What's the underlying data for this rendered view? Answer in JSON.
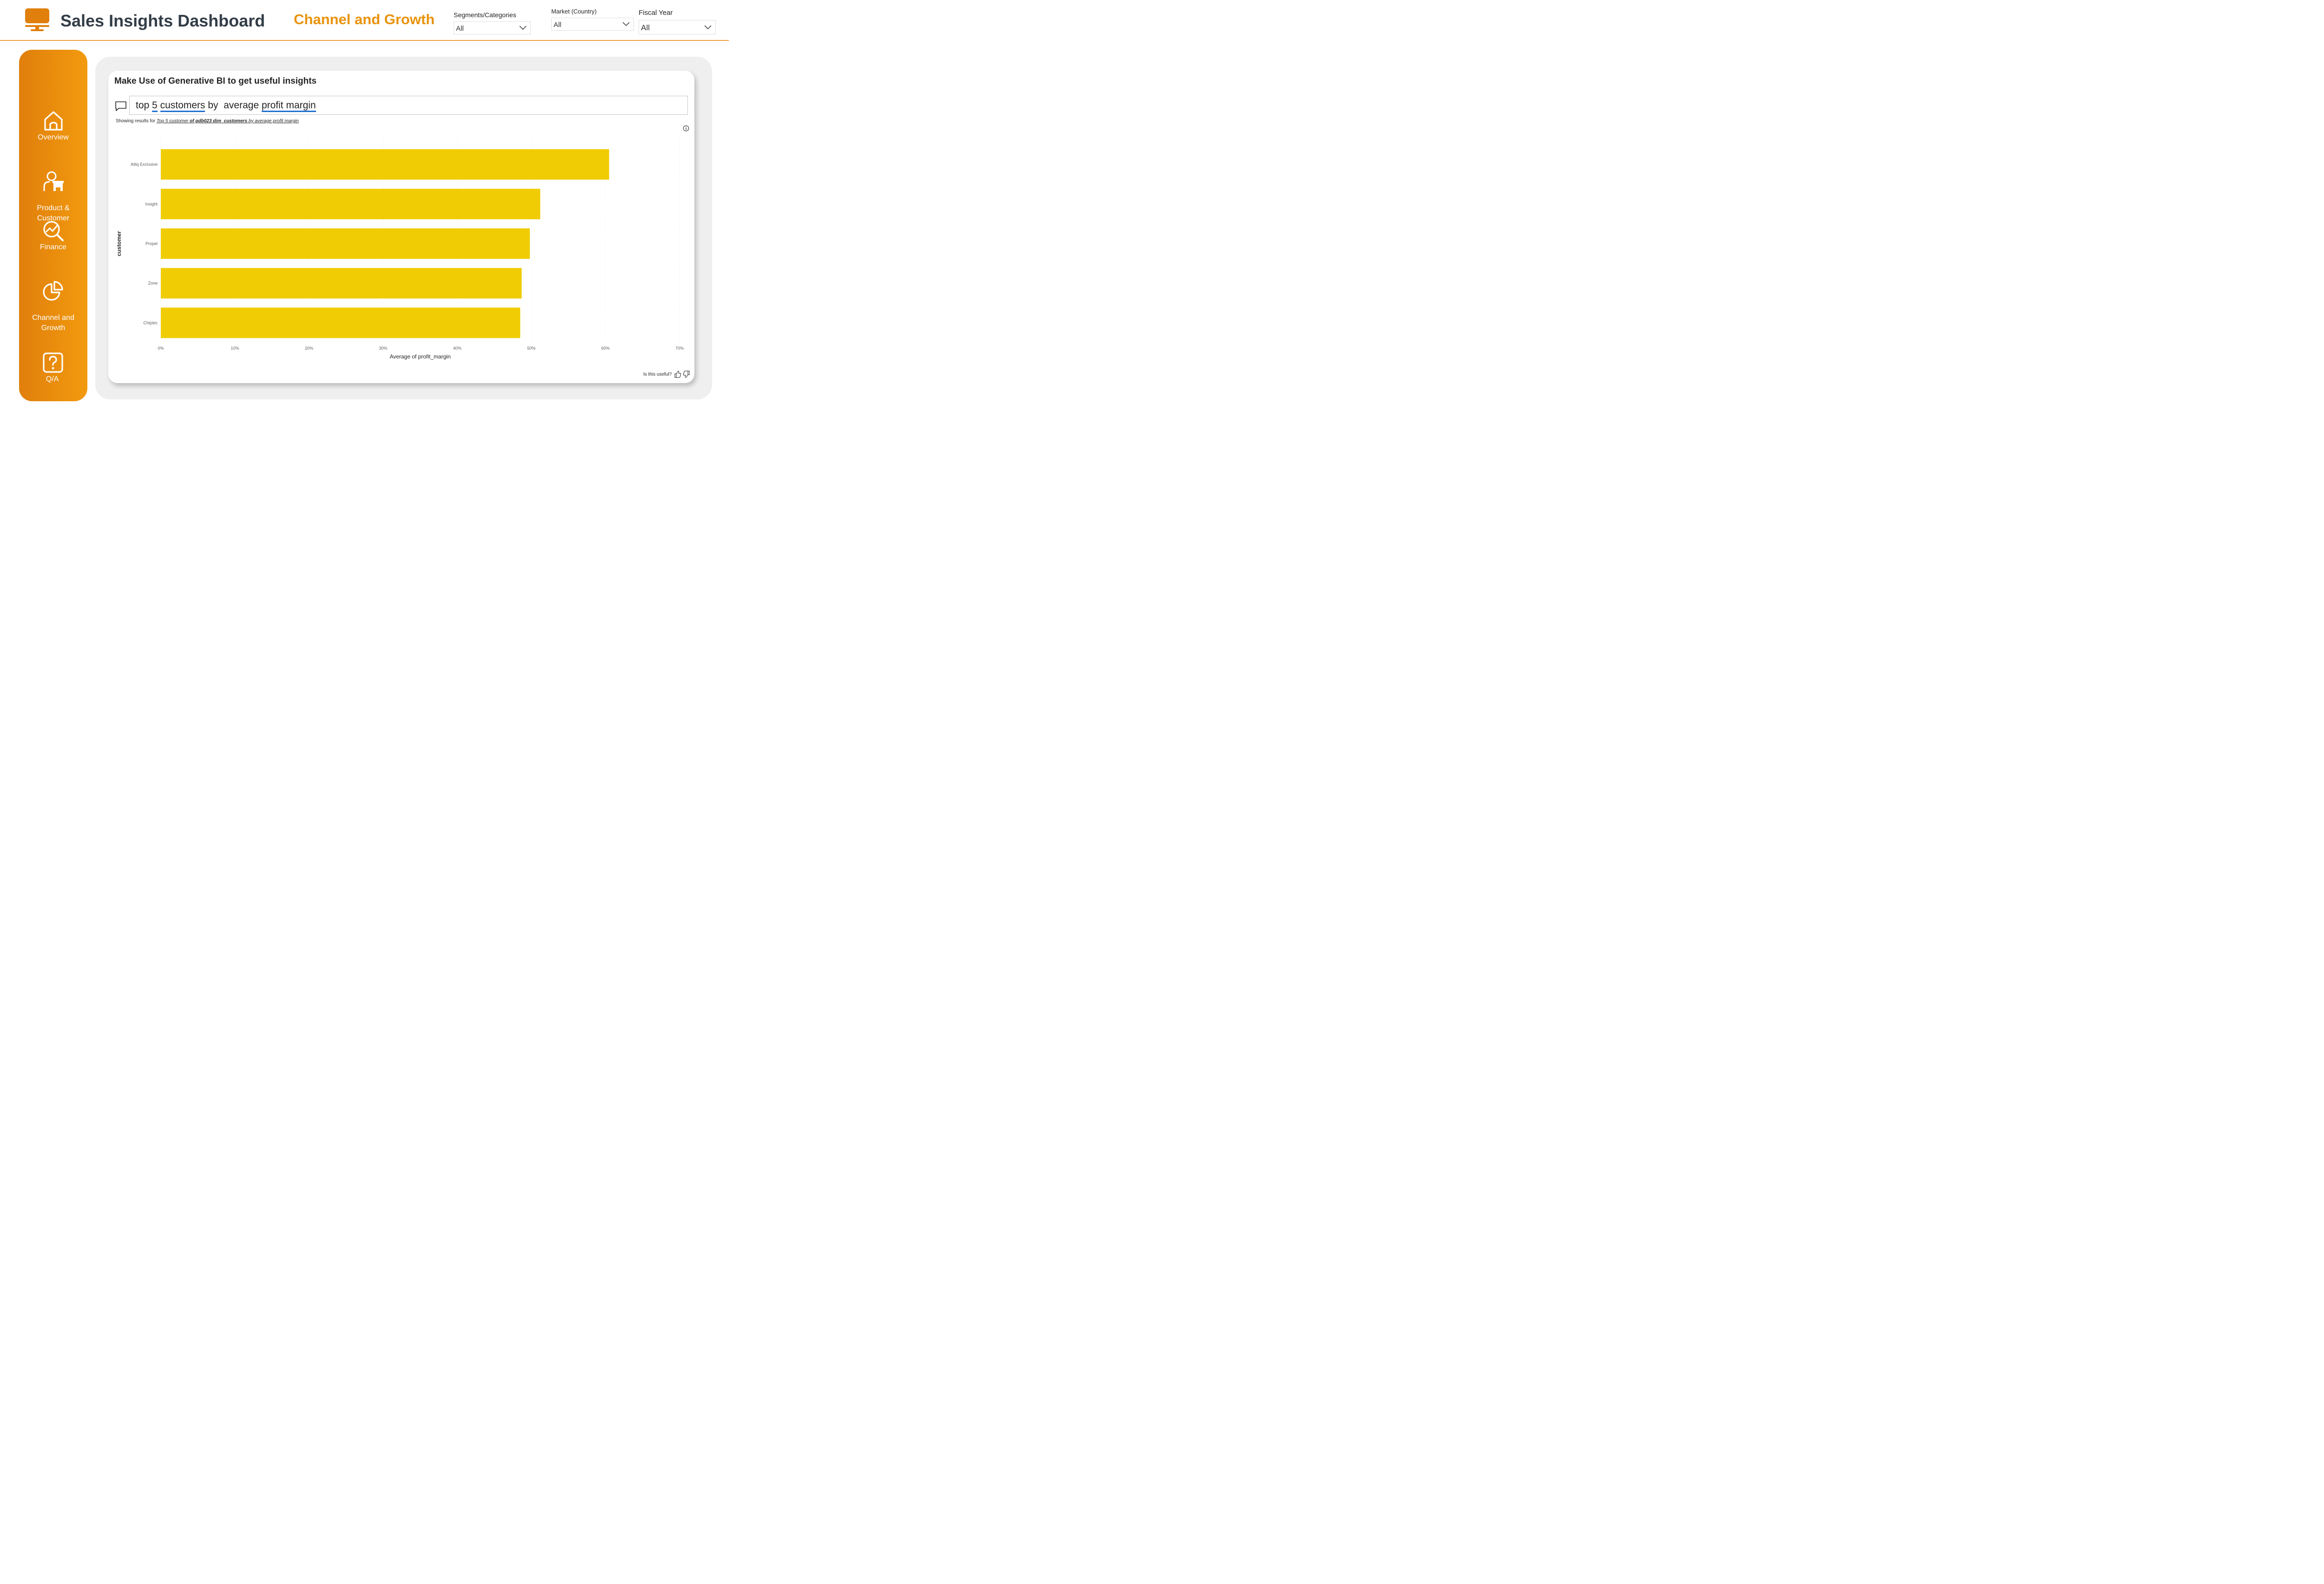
{
  "header": {
    "app_title": "Sales Insights Dashboard",
    "page_title": "Channel and Growth",
    "logo_icon": "monitor-icon",
    "accent_color": "#e8930c"
  },
  "slicers": [
    {
      "label": "Segments/Categories",
      "value": "All"
    },
    {
      "label": "Market (Country)",
      "value": "All"
    },
    {
      "label": "Fiscal Year",
      "value": "All"
    }
  ],
  "sidebar": {
    "items": [
      {
        "label": "Overview",
        "icon": "home-icon"
      },
      {
        "label": "Product &\nCustomer",
        "icon": "person-store-icon"
      },
      {
        "label": "Finance",
        "icon": "search-chart-icon"
      },
      {
        "label": "Channel and\nGrowth",
        "icon": "pie-chart-icon"
      },
      {
        "label": "Q/A",
        "icon": "question-icon"
      }
    ]
  },
  "card": {
    "title": "Make Use of Generative BI to get useful insights",
    "query": {
      "parts": [
        {
          "text": "top ",
          "u": false
        },
        {
          "text": "5",
          "u": true
        },
        {
          "text": " ",
          "u": false
        },
        {
          "text": "customers",
          "u": true
        },
        {
          "text": " by  average ",
          "u": false
        },
        {
          "text": "profit margin",
          "u": true
        }
      ]
    },
    "showing_prefix": "Showing results for ",
    "showing_part1": "Top 5 customer ",
    "showing_part2": "of gdb023 dim_customers",
    "showing_part3": " by average profit margin",
    "feedback_label": "Is this useful?"
  },
  "chart_data": {
    "type": "bar",
    "orientation": "horizontal",
    "categories": [
      "Atliq Exclusive",
      "Insight",
      "Propel",
      "Zone",
      "Chiptec"
    ],
    "values": [
      0.605,
      0.512,
      0.498,
      0.487,
      0.485
    ],
    "xlabel": "Average of profit_margin",
    "ylabel": "customer",
    "xlim": [
      0,
      0.7
    ],
    "xticks": [
      "0%",
      "10%",
      "20%",
      "30%",
      "40%",
      "50%",
      "60%",
      "70%"
    ],
    "bar_color": "#f0cc05",
    "grid": true
  }
}
